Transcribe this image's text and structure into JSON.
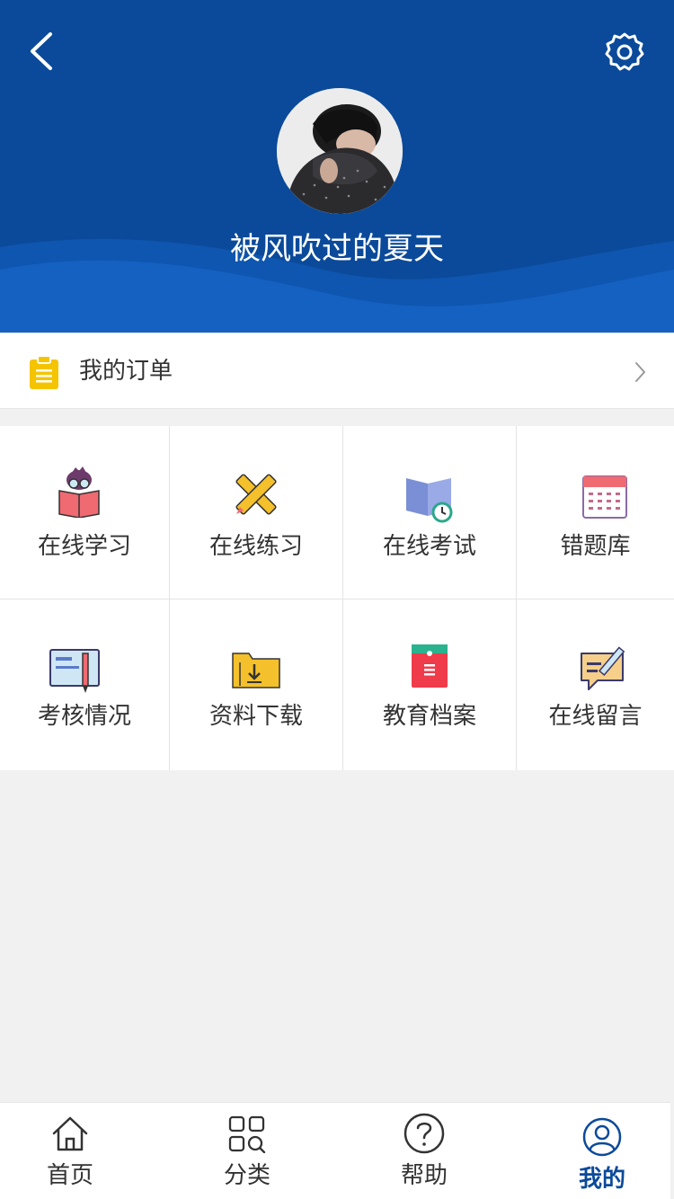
{
  "header": {
    "username": "被风吹过的夏天",
    "back_icon": "chevron-left-icon",
    "settings_icon": "gear-icon",
    "avatar_icon": "avatar-photo",
    "bg_color": "#0b4a9a"
  },
  "orders": {
    "label": "我的订单",
    "icon": "clipboard-icon",
    "icon_color": "#f5c400"
  },
  "features": [
    {
      "label": "在线学习",
      "icon": "reading-student-icon"
    },
    {
      "label": "在线练习",
      "icon": "pencil-ruler-icon"
    },
    {
      "label": "在线考试",
      "icon": "book-clock-icon"
    },
    {
      "label": "错题库",
      "icon": "calendar-icon"
    },
    {
      "label": "考核情况",
      "icon": "form-pen-icon"
    },
    {
      "label": "资料下载",
      "icon": "folder-download-icon"
    },
    {
      "label": "教育档案",
      "icon": "archive-file-icon"
    },
    {
      "label": "在线留言",
      "icon": "message-edit-icon"
    }
  ],
  "tabbar": {
    "active_color": "#0b4a9a",
    "items": [
      {
        "label": "首页",
        "icon": "home-icon"
      },
      {
        "label": "分类",
        "icon": "category-grid-icon"
      },
      {
        "label": "帮助",
        "icon": "help-icon"
      },
      {
        "label": "我的",
        "icon": "user-icon",
        "active": true
      }
    ]
  }
}
